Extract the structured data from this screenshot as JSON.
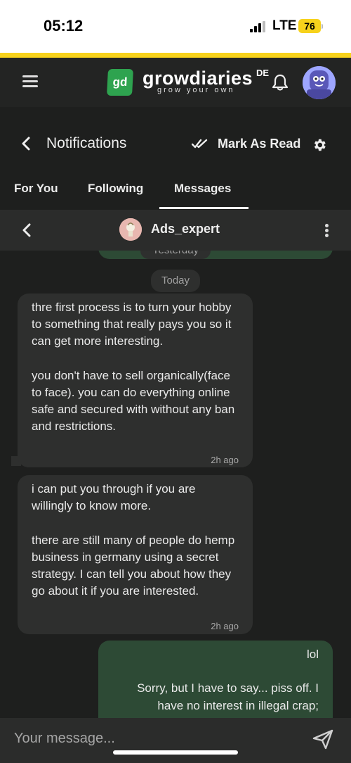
{
  "status_bar": {
    "time": "05:12",
    "network": "LTE",
    "battery": "76"
  },
  "app_header": {
    "logo_mark": "gd",
    "logo_name": "growdiaries",
    "logo_tagline": "grow your own",
    "language": "DE",
    "menu_icon": "hamburger-icon",
    "bell_icon": "bell-icon"
  },
  "notifications_bar": {
    "title": "Notifications",
    "mark_as_read": "Mark As Read",
    "settings_icon": "gear-icon"
  },
  "tabs": [
    {
      "label": "For You",
      "active": false
    },
    {
      "label": "Following",
      "active": false
    },
    {
      "label": "Messages",
      "active": true
    }
  ],
  "conversation": {
    "name": "Ads_expert",
    "previous_day_label": "Yesterday",
    "today_label": "Today",
    "messages": [
      {
        "direction": "incoming",
        "text": "thre first process is to turn your hobby to something that really pays you so it can get more interesting.\n\nyou don't have to sell organically(face to face). you can do everything online safe and secured with without any ban and restrictions.",
        "time": "2h ago"
      },
      {
        "direction": "incoming",
        "text": "i can put you through if you are willingly to know more.\n\nthere are still many of people do hemp business in germany using a secret strategy. I can tell you about how they go about it if you are interested.",
        "time": "2h ago"
      },
      {
        "direction": "outgoing",
        "text": "lol\n\nSorry, but I have to say... piss off. I have no interest in illegal crap;",
        "time": ""
      }
    ]
  },
  "composer": {
    "placeholder": "Your message...",
    "send_icon": "send-icon"
  },
  "colors": {
    "brand_green": "#2ea34f",
    "accent_yellow": "#f7d21c",
    "outgoing_bubble": "#2d4a35",
    "incoming_bubble": "#2e2f2e",
    "background": "#1e1f1e"
  }
}
